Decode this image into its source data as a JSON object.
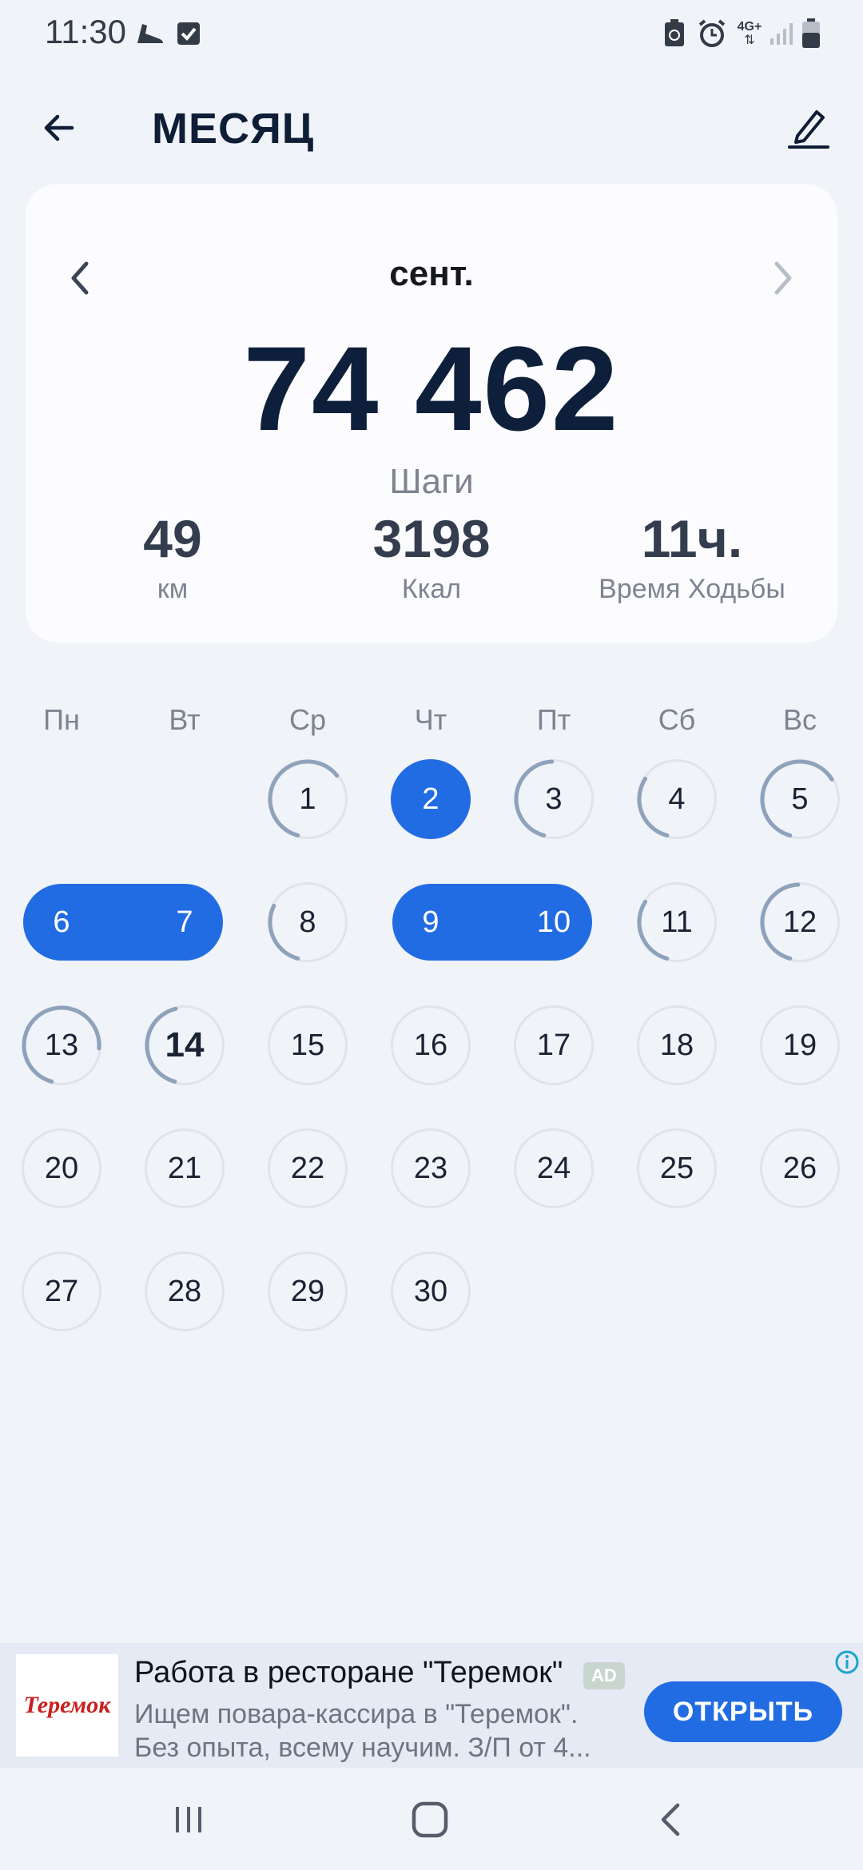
{
  "status_bar": {
    "time": "11:30",
    "icons": [
      "shoe-icon",
      "checkbox-icon",
      "battery-saver-icon",
      "alarm-icon",
      "network-4g-icon",
      "signal-icon",
      "battery-icon"
    ],
    "network_label": "4G+"
  },
  "header": {
    "title": "МЕСЯЦ",
    "back_icon": "arrow-left-icon",
    "edit_icon": "pencil-icon"
  },
  "summary": {
    "month": "сент.",
    "steps_value": "74 462",
    "steps_label": "Шаги",
    "stats": [
      {
        "value": "49",
        "label": "км"
      },
      {
        "value": "3198",
        "label": "Ккал"
      },
      {
        "value": "11ч.",
        "label": "Время Ходьбы"
      }
    ]
  },
  "calendar": {
    "weekdays": [
      "Пн",
      "Вт",
      "Ср",
      "Чт",
      "Пт",
      "Сб",
      "Вс"
    ],
    "days": [
      {
        "num": "1",
        "progress": 0.6
      },
      {
        "num": "2",
        "progress": 1.0,
        "goal_reached": true
      },
      {
        "num": "3",
        "progress": 0.45
      },
      {
        "num": "4",
        "progress": 0.3
      },
      {
        "num": "5",
        "progress": 0.62
      },
      {
        "num": "6",
        "progress": 1.0,
        "goal_reached": true
      },
      {
        "num": "7",
        "progress": 1.0,
        "goal_reached": true
      },
      {
        "num": "8",
        "progress": 0.28
      },
      {
        "num": "9",
        "progress": 1.0,
        "goal_reached": true
      },
      {
        "num": "10",
        "progress": 1.0,
        "goal_reached": true
      },
      {
        "num": "11",
        "progress": 0.3
      },
      {
        "num": "12",
        "progress": 0.45
      },
      {
        "num": "13",
        "progress": 0.72
      },
      {
        "num": "14",
        "progress": 0.42,
        "today": true
      },
      {
        "num": "15",
        "progress": 0
      },
      {
        "num": "16",
        "progress": 0
      },
      {
        "num": "17",
        "progress": 0
      },
      {
        "num": "18",
        "progress": 0
      },
      {
        "num": "19",
        "progress": 0
      },
      {
        "num": "20",
        "progress": 0
      },
      {
        "num": "21",
        "progress": 0
      },
      {
        "num": "22",
        "progress": 0
      },
      {
        "num": "23",
        "progress": 0
      },
      {
        "num": "24",
        "progress": 0
      },
      {
        "num": "25",
        "progress": 0
      },
      {
        "num": "26",
        "progress": 0
      },
      {
        "num": "27",
        "progress": 0
      },
      {
        "num": "28",
        "progress": 0
      },
      {
        "num": "29",
        "progress": 0
      },
      {
        "num": "30",
        "progress": 0
      }
    ]
  },
  "ad": {
    "logo_text": "Теремок",
    "title": "Работа в ресторане \"Теремок\"",
    "badge": "AD",
    "desc_line1": "Ищем повара-кассира в \"Теремок\".",
    "desc_line2": "Без опыта, всему научим. З/П от 4...",
    "button": "ОТКРЫТЬ"
  },
  "navbar": {
    "buttons": [
      "recent-apps-icon",
      "home-icon",
      "back-icon"
    ]
  },
  "colors": {
    "accent": "#226ce3",
    "ring_progress": "#8fa2bb",
    "ring_track": "#e0e4ea",
    "background": "#f0f3f8"
  }
}
